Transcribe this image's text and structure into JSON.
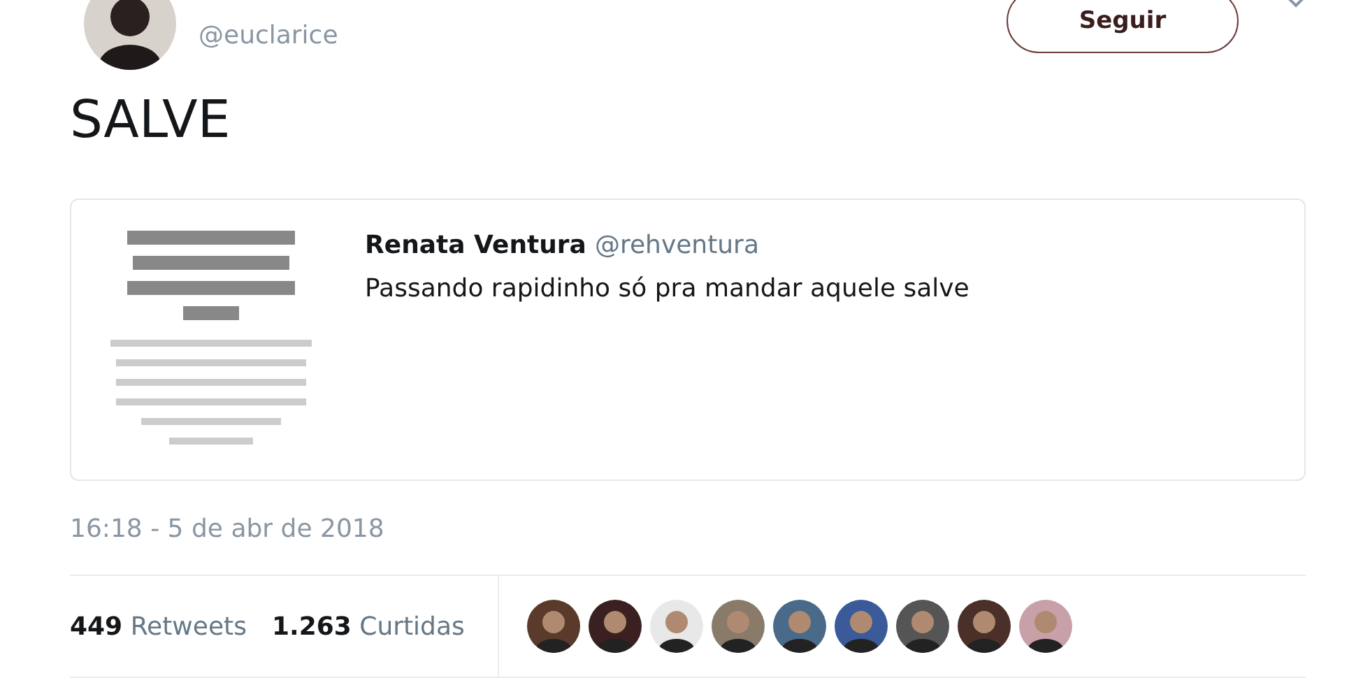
{
  "author": {
    "handle": "@euclarice"
  },
  "follow_button": {
    "label": "Seguir"
  },
  "tweet_text": "SALVE",
  "quoted_tweet": {
    "name": "Renata Ventura",
    "handle": "@rehventura",
    "text": "Passando rapidinho só pra mandar aquele salve"
  },
  "timestamp": "16:18 - 5 de abr de 2018",
  "stats": [
    {
      "count": "449",
      "label": "Retweets"
    },
    {
      "count": "1.263",
      "label": "Curtidas"
    }
  ]
}
